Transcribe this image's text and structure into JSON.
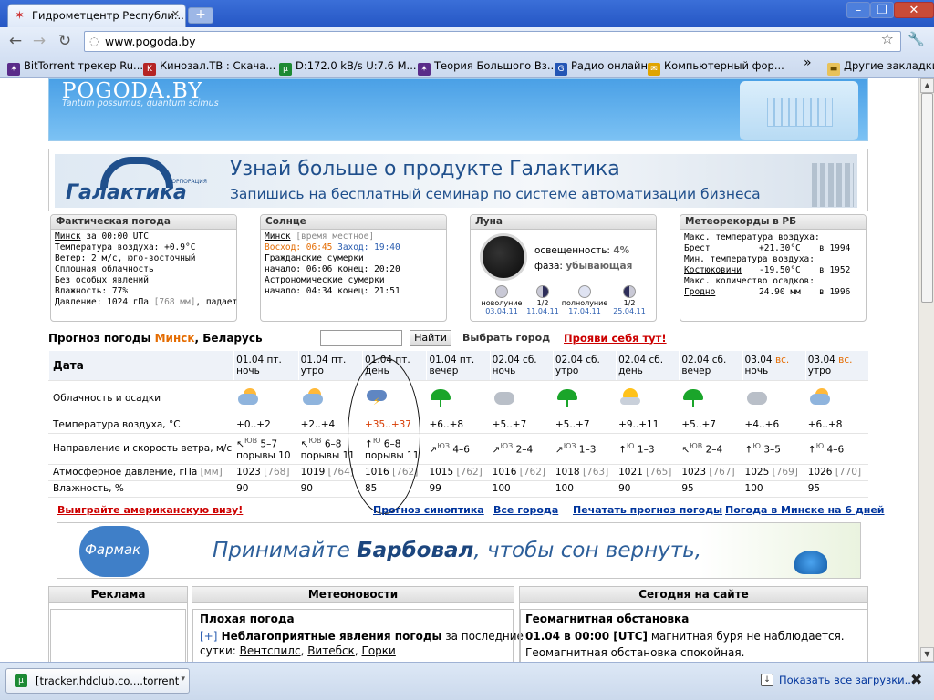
{
  "browser": {
    "tab_title": "Гидрометцентр Республи...",
    "tab_close": "✕",
    "new_tab": "+",
    "url": "www.pogoda.by",
    "bookmarks": [
      {
        "label": "BitTorrent трекер Ru...",
        "icon_color": "#5a2c8a"
      },
      {
        "label": "Кинозал.ТВ : Скача...",
        "icon_color": "#b52424"
      },
      {
        "label": "D:172.0 kB/s U:7.6 M...",
        "icon_color": "#1d8a34"
      },
      {
        "label": "Теория Большого Вз...",
        "icon_color": "#5a2c8a"
      },
      {
        "label": "Радио онлайн",
        "icon_color": "#2456b5"
      },
      {
        "label": "Компьютерный фор...",
        "icon_color": "#e0a400"
      }
    ],
    "bookmarks_overflow": "»",
    "other_bookmarks": "Другие закладки"
  },
  "site": {
    "logo": "POGODA.BY",
    "tagline": "Tantum possumus, quantum scimus"
  },
  "banner_galaktika": {
    "brand": "Галактика",
    "corp": "КОРПОРАЦИЯ",
    "line1": "Узнай больше о продукте Галактика",
    "line2": "Запишись на бесплатный семинар по системе автоматизации бизнеса"
  },
  "actual": {
    "title": "Фактическая погода",
    "city": "Минск",
    "time": " за 00:00 UTC",
    "temp": "Температура воздуха: +0.9°C",
    "wind": "Ветер: 2 м/с, юго-восточный",
    "clouds": "Сплошная облачность",
    "events": "Без особых явлений",
    "humidity": "Влажность: 77%",
    "pressure": "Давление: 1024 гПа ",
    "pressure_mm": "[768 мм]",
    "pressure_trend": ", падает"
  },
  "sun": {
    "title": "Солнце",
    "city": "Минск",
    "time_note": " [время местное]",
    "sunrise_label": "Восход: 06:45",
    "sunset_label": "Заход: 19:40",
    "civil": "Гражданские сумерки",
    "civil_times": "начало: 06:06 конец: 20:20",
    "astro": "Астрономические сумерки",
    "astro_times": "начало: 04:34 конец: 21:51"
  },
  "moon": {
    "title": "Луна",
    "illum_label": "освещенность:",
    "illum_value": "4%",
    "phase_label": "фаза:",
    "phase_value": "убывающая",
    "phases": [
      {
        "name": "новолуние",
        "date": "03.04.11"
      },
      {
        "name": "1/2",
        "date": "11.04.11"
      },
      {
        "name": "полнолуние",
        "date": "17.04.11"
      },
      {
        "name": "1/2",
        "date": "25.04.11"
      }
    ]
  },
  "records": {
    "title": "Метеорекорды в РБ",
    "max_temp_label": "Макс. температура воздуха:",
    "max_city": "Брест",
    "max_value": "+21.30°C",
    "max_year": "в 1994",
    "min_temp_label": "Мин. температура воздуха:",
    "min_city": "Костюковичи",
    "min_value": "-19.50°C",
    "min_year": "в 1952",
    "precip_label": "Макс. количество осадков:",
    "precip_city": "Гродно",
    "precip_value": "24.90 мм",
    "precip_year": "в 1996"
  },
  "forecast": {
    "title_prefix": "Прогноз погоды ",
    "city": "Минск",
    "title_suffix": ", Беларусь",
    "search_button": "Найти",
    "choose_city": "Выбрать город",
    "promo": "Прояви себя тут!",
    "row_labels": {
      "date": "Дата",
      "clouds": "Облачность и осадки",
      "temp": "Температура воздуха, °С",
      "wind": "Направление и скорость ветра, м/с",
      "pressure": "Атмосферное давление, гПа ",
      "pressure_unit": "[мм]",
      "humidity": "Влажность, %"
    },
    "columns": [
      {
        "date": "01.04 пт.",
        "period": "ночь",
        "icon": "partly-cloudy",
        "temp": "+0..+2",
        "wind_dir": "ЮВ",
        "wind_arrow": "↖",
        "wind": "5–7",
        "gusts": "порывы 10",
        "pressure": "1023",
        "pressure_mm": "[768]",
        "humidity": "90"
      },
      {
        "date": "01.04 пт.",
        "period": "утро",
        "icon": "partly-cloudy",
        "temp": "+2..+4",
        "wind_dir": "ЮВ",
        "wind_arrow": "↖",
        "wind": "6–8",
        "gusts": "порывы 11",
        "pressure": "1019",
        "pressure_mm": "[764]",
        "humidity": "90"
      },
      {
        "date": "01.04 пт.",
        "period": "день",
        "icon": "thunder",
        "temp": "+35..+37",
        "wind_dir": "Ю",
        "wind_arrow": "↑",
        "wind": "6–8",
        "gusts": "порывы 11",
        "pressure": "1016",
        "pressure_mm": "[762]",
        "humidity": "85"
      },
      {
        "date": "01.04 пт.",
        "period": "вечер",
        "icon": "rain",
        "temp": "+6..+8",
        "wind_dir": "ЮЗ",
        "wind_arrow": "↗",
        "wind": "4–6",
        "gusts": "",
        "pressure": "1015",
        "pressure_mm": "[762]",
        "humidity": "99"
      },
      {
        "date": "02.04 сб.",
        "period": "ночь",
        "icon": "cloudy",
        "temp": "+5..+7",
        "wind_dir": "ЮЗ",
        "wind_arrow": "↗",
        "wind": "2–4",
        "gusts": "",
        "pressure": "1016",
        "pressure_mm": "[762]",
        "humidity": "100"
      },
      {
        "date": "02.04 сб.",
        "period": "утро",
        "icon": "rain",
        "temp": "+5..+7",
        "wind_dir": "ЮЗ",
        "wind_arrow": "↗",
        "wind": "1–3",
        "gusts": "",
        "pressure": "1018",
        "pressure_mm": "[763]",
        "humidity": "100"
      },
      {
        "date": "02.04 сб.",
        "period": "день",
        "icon": "sunny-cloud",
        "temp": "+9..+11",
        "wind_dir": "Ю",
        "wind_arrow": "↑",
        "wind": "1–3",
        "gusts": "",
        "pressure": "1021",
        "pressure_mm": "[765]",
        "humidity": "90"
      },
      {
        "date": "02.04 сб.",
        "period": "вечер",
        "icon": "rain",
        "temp": "+5..+7",
        "wind_dir": "ЮВ",
        "wind_arrow": "↖",
        "wind": "2–4",
        "gusts": "",
        "pressure": "1023",
        "pressure_mm": "[767]",
        "humidity": "95"
      },
      {
        "date": "03.04 ",
        "date_hl": "вс.",
        "period": "ночь",
        "icon": "cloudy",
        "temp": "+4..+6",
        "wind_dir": "Ю",
        "wind_arrow": "↑",
        "wind": "3–5",
        "gusts": "",
        "pressure": "1025",
        "pressure_mm": "[769]",
        "humidity": "100"
      },
      {
        "date": "03.04 ",
        "date_hl": "вс.",
        "period": "утро",
        "icon": "partly-cloudy",
        "temp": "+6..+8",
        "wind_dir": "Ю",
        "wind_arrow": "↑",
        "wind": "4–6",
        "gusts": "",
        "pressure": "1026",
        "pressure_mm": "[770]",
        "humidity": "95"
      }
    ]
  },
  "links": {
    "visa": "Выиграйте американскую визу!",
    "synoptic": "Прогноз синоптика",
    "cities": "Все города",
    "print": "Печатать прогноз погоды",
    "six_days": "Погода в Минске на 6 дней"
  },
  "banner_farmak": {
    "brand": "Фармак",
    "slogan_pre": "Принимайте ",
    "slogan_bold": "Барбовал",
    "slogan_post": ", чтобы сон вернуть,"
  },
  "bottom": {
    "ads_title": "Реклама",
    "news_title": "Метеоновости",
    "news_head": "Плохая погода",
    "news_plus": "[+]",
    "news_text": " Неблагоприятные явления погоды",
    "news_text2": " за последние",
    "news_text3": "сутки: ",
    "news_city1": "Вентспилс",
    "news_city2": "Витебск",
    "news_city3": "Горки",
    "today_title": "Сегодня на сайте",
    "today_head": "Геомагнитная обстановка",
    "today_line1_bold": "01.04 в 00:00 [UTC]",
    "today_line1": " магнитная буря не наблюдается.",
    "today_line2": "Геомагнитная обстановка спокойная."
  },
  "downloads": {
    "item": "[tracker.hdclub.co....torrent",
    "show_all": "Показать все загрузки..."
  }
}
